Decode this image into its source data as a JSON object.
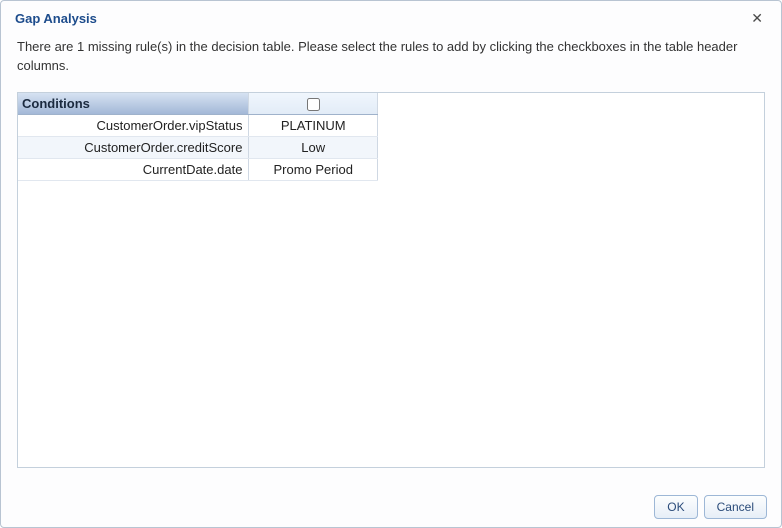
{
  "dialog": {
    "title": "Gap Analysis",
    "instructions": "There are 1 missing rule(s) in the decision table. Please select the rules to add by clicking the checkboxes in the table header columns."
  },
  "table": {
    "conditions_header": "Conditions",
    "rules": [
      {
        "checked": false
      }
    ],
    "rows": [
      {
        "condition": "CustomerOrder.vipStatus",
        "values": [
          "PLATINUM"
        ]
      },
      {
        "condition": "CustomerOrder.creditScore",
        "values": [
          "Low"
        ]
      },
      {
        "condition": "CurrentDate.date",
        "values": [
          "Promo Period"
        ]
      }
    ]
  },
  "buttons": {
    "ok": "OK",
    "cancel": "Cancel"
  },
  "icons": {
    "close": "✕"
  }
}
